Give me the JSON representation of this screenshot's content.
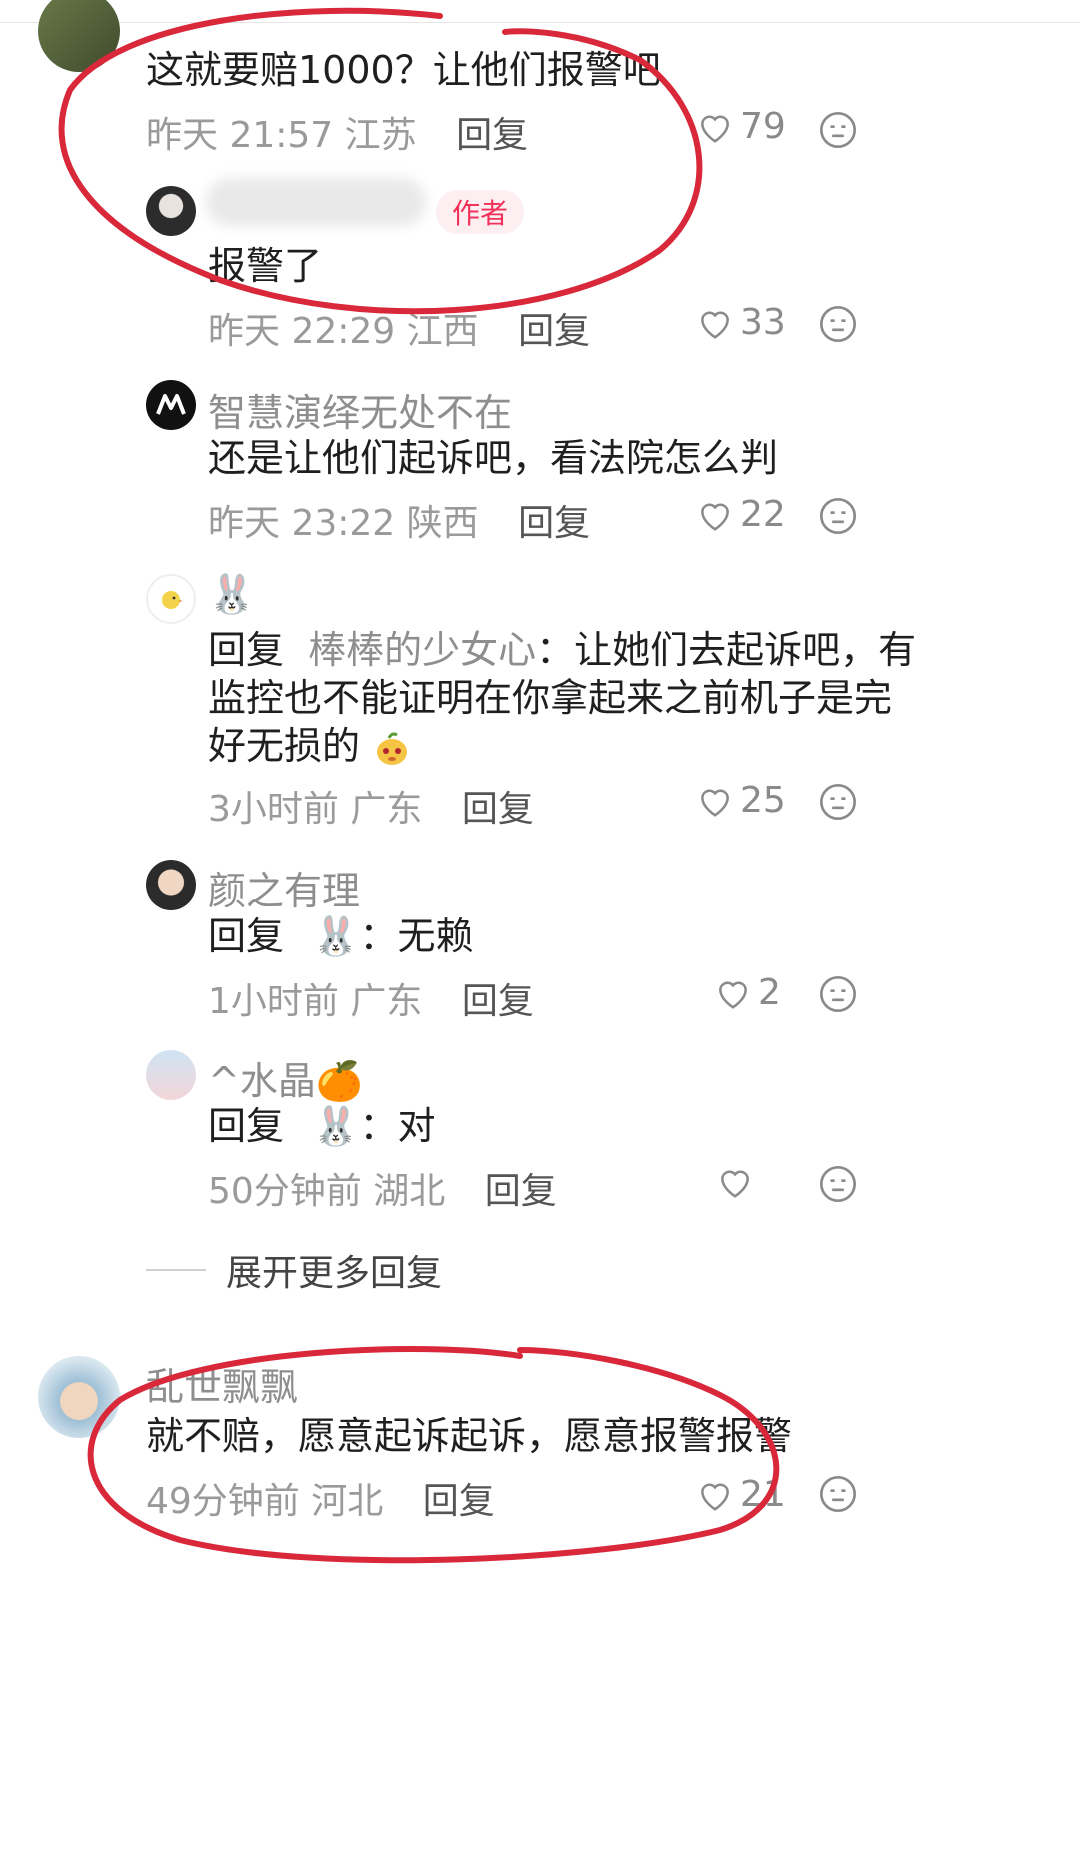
{
  "colors": {
    "accent": "#f0325a",
    "meta": "#9a9a9a",
    "name": "#8e8e8e",
    "annotation": "#d8283a"
  },
  "comments": [
    {
      "text": "这就要赔1000？让他们报警吧",
      "time": "昨天 21:57",
      "region": "江苏",
      "reply": "回复",
      "likes": "79"
    },
    {
      "author_badge": "作者",
      "text": "报警了",
      "time": "昨天 22:29",
      "region": "江西",
      "reply": "回复",
      "likes": "33"
    },
    {
      "name": "智慧演绎无处不在",
      "text": "还是让他们起诉吧，看法院怎么判",
      "time": "昨天 23:22",
      "region": "陕西",
      "reply": "回复",
      "likes": "22"
    },
    {
      "name": "🐰",
      "reply_prefix": "回复",
      "reply_to": "棒棒的少女心",
      "text_line1_rest": "：让她们去起诉吧，有",
      "text_line2": "监控也不能证明在你拿起来之前机子是完",
      "text_line3": "好无损的",
      "time": "3小时前",
      "region": "广东",
      "reply": "回复",
      "likes": "25"
    },
    {
      "name": "颜之有理",
      "reply_prefix": "回复",
      "reply_target": "🐰",
      "text_rest": "：无赖",
      "time": "1小时前",
      "region": "广东",
      "reply": "回复",
      "likes": "2"
    },
    {
      "name": "^水晶🍊",
      "reply_prefix": "回复",
      "reply_target": "🐰",
      "text_rest": "：对",
      "time": "50分钟前",
      "region": "湖北",
      "reply": "回复",
      "likes": ""
    },
    {
      "name": "乱世飘飘",
      "text": "就不赔，愿意起诉起诉，愿意报警报警",
      "time": "49分钟前",
      "region": "河北",
      "reply": "回复",
      "likes": "21"
    }
  ],
  "expand_label": "展开更多回复",
  "icons": {
    "like": "heart-outline-icon",
    "dislike": "neutral-face-icon",
    "emoji": "mango-face-emoji"
  }
}
